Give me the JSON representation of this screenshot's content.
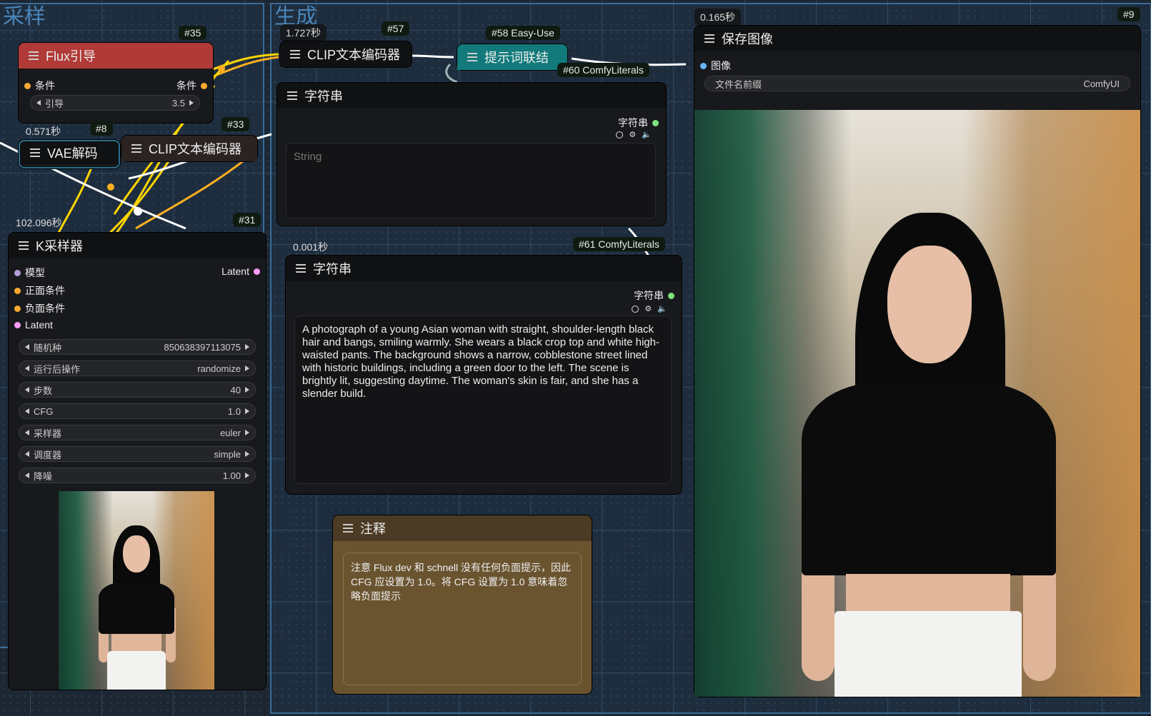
{
  "groups": {
    "sampling": "采样",
    "generate": "生成"
  },
  "nodes": {
    "flux_guidance": {
      "id": "#35",
      "title": "Flux引导",
      "input": "条件",
      "output": "条件",
      "widget_label": "引导",
      "widget_value": "3.5"
    },
    "vae_decode": {
      "id": "#8",
      "title": "VAE解码",
      "time": "0.571秒"
    },
    "clip_33": {
      "id": "#33",
      "title": "CLIP文本编码器"
    },
    "ksampler": {
      "id": "#31",
      "title": "K采样器",
      "time": "102.096秒",
      "inputs": [
        "模型",
        "正面条件",
        "负面条件",
        "Latent"
      ],
      "output": "Latent",
      "widgets": [
        {
          "label": "随机种",
          "value": "850638397113075"
        },
        {
          "label": "运行后操作",
          "value": "randomize"
        },
        {
          "label": "步数",
          "value": "40"
        },
        {
          "label": "CFG",
          "value": "1.0"
        },
        {
          "label": "采样器",
          "value": "euler"
        },
        {
          "label": "调度器",
          "value": "simple"
        },
        {
          "label": "降噪",
          "value": "1.00"
        }
      ]
    },
    "clip_57": {
      "id": "#57",
      "title": "CLIP文本编码器",
      "time": "1.727秒"
    },
    "prompt_join": {
      "id": "#58 Easy-Use",
      "title": "提示词联结"
    },
    "string_60": {
      "id": "#60 ComfyLiterals",
      "title": "字符串",
      "output": "字符串",
      "placeholder": "String"
    },
    "string_61": {
      "id": "#61 ComfyLiterals",
      "title": "字符串",
      "output": "字符串",
      "time": "0.001秒",
      "text": "A photograph of a young Asian woman with straight, shoulder-length black hair and bangs, smiling warmly. She wears a black crop top and white high-waisted pants. The background shows a narrow, cobblestone street lined with historic buildings, including a green door to the left. The scene is brightly lit, suggesting daytime. The woman's skin is fair, and she has a slender build."
    },
    "note": {
      "title": "注释",
      "text": "注意 Flux dev 和 schnell 没有任何负面提示，因此 CFG 应设置为 1.0。将 CFG 设置为 1.0 意味着忽略负面提示"
    },
    "save_image": {
      "id": "#9",
      "title": "保存图像",
      "time": "0.165秒",
      "input": "图像",
      "widget_label": "文件名前缀",
      "widget_value": "ComfyUI"
    }
  },
  "colors": {
    "cond": "#ffa931",
    "latent": "#ff9cf9",
    "model": "#b39ddb",
    "string": "#7ee27e",
    "image": "#64b5f6",
    "wire_yellow": "#ffd500",
    "wire_white": "#ffffff"
  },
  "icons": {
    "menu": "hamburger-icon",
    "left": "arrow-left-icon",
    "right": "arrow-right-icon",
    "gear": "gear-icon",
    "speaker": "speaker-icon"
  }
}
